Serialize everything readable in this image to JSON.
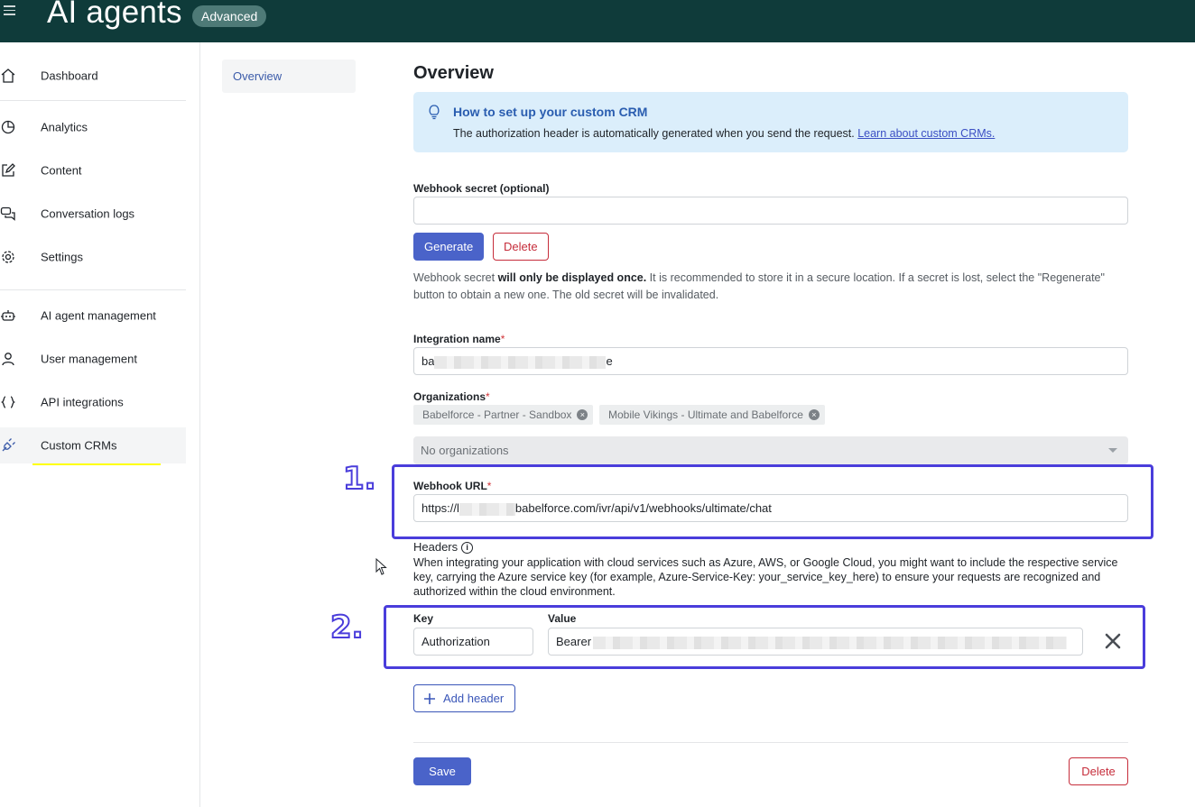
{
  "header": {
    "title": "AI agents",
    "badge": "Advanced"
  },
  "sidebar": {
    "items": [
      {
        "label": "Dashboard",
        "icon": "home-icon"
      },
      {
        "label": "Analytics",
        "icon": "pie-chart-icon"
      },
      {
        "label": "Content",
        "icon": "edit-icon"
      },
      {
        "label": "Conversation logs",
        "icon": "chat-bubbles-icon"
      },
      {
        "label": "Settings",
        "icon": "gear-icon"
      },
      {
        "label": "AI agent management",
        "icon": "robot-icon"
      },
      {
        "label": "User management",
        "icon": "user-icon"
      },
      {
        "label": "API integrations",
        "icon": "braces-icon"
      },
      {
        "label": "Custom CRMs",
        "icon": "plug-icon",
        "active": true
      }
    ]
  },
  "subnav": {
    "overview": "Overview"
  },
  "main": {
    "title": "Overview",
    "info": {
      "title": "How to set up your custom CRM",
      "text": "The authorization header is automatically generated when you send the request. ",
      "link": "Learn about custom CRMs."
    },
    "webhook_secret": {
      "label": "Webhook secret (optional)",
      "value": "",
      "generate": "Generate",
      "delete": "Delete",
      "help_prefix": "Webhook secret ",
      "help_bold": "will only be displayed once.",
      "help_rest": " It is recommended to store it in a secure location. If a secret is lost, select the \"Regenerate\" button to obtain a new one. The old secret will be invalidated."
    },
    "integration_name": {
      "label": "Integration name",
      "required": "*",
      "value_start": "ba",
      "value_end": "e"
    },
    "organizations": {
      "label": "Organizations",
      "required": "*",
      "chips": [
        "Babelforce - Partner - Sandbox",
        "Mobile Vikings - Ultimate and Babelforce"
      ],
      "chip_remove": "×",
      "placeholder": "No organizations"
    },
    "webhook_url": {
      "label": "Webhook URL",
      "required": "*",
      "value_start": "https://l",
      "value_end": "babelforce.com/ivr/api/v1/webhooks/ultimate/chat"
    },
    "headers": {
      "label": "Headers",
      "info_glyph": "i",
      "description": "When integrating your application with cloud services such as Azure, AWS, or Google Cloud, you might want to include the respective service key, carrying the Azure service key (for example, Azure-Service-Key: your_service_key_here) to ensure your requests are recognized and authorized within the cloud environment.",
      "key_label": "Key",
      "value_label": "Value",
      "key_value": "Authorization",
      "value_start": "Bearer",
      "add_header": "Add header"
    },
    "save": "Save",
    "delete": "Delete"
  },
  "annotations": {
    "one": "1.",
    "two": "2."
  },
  "colors": {
    "topbar": "#0f3b3a",
    "primary": "#4a63c9",
    "danger": "#c62d3b",
    "callout": "#4a3ddb",
    "highlight": "#ffff00",
    "info_bg": "#dbeefb"
  }
}
